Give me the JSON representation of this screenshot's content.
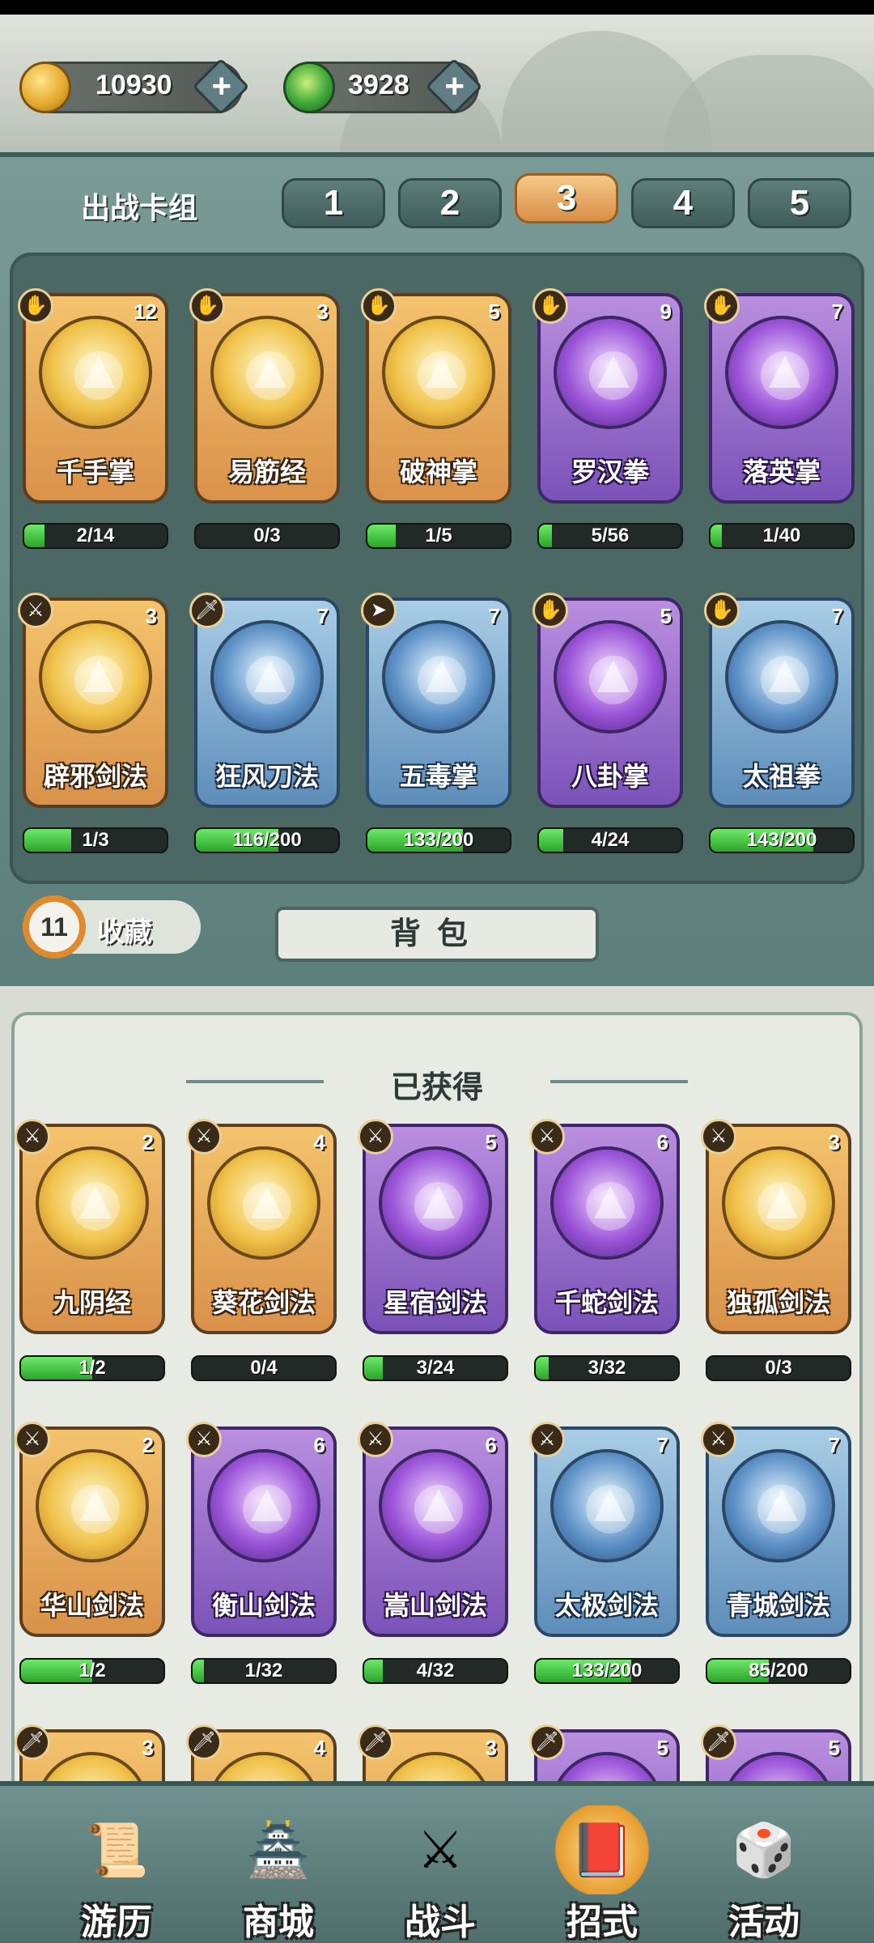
{
  "resources": {
    "gold": {
      "icon": "gold-coin-icon",
      "value": "10930",
      "add_label": "+"
    },
    "jade": {
      "icon": "jade-orb-icon",
      "value": "3928",
      "add_label": "+"
    }
  },
  "deck": {
    "label": "出战卡组",
    "tabs": [
      "1",
      "2",
      "3",
      "4",
      "5"
    ],
    "active_tab": "3",
    "cards": [
      {
        "name": "千手掌",
        "level": "12",
        "type_icon": "palm-icon",
        "rarity": "gold",
        "progress": "2/14",
        "fill": 0.14
      },
      {
        "name": "易筋经",
        "level": "3",
        "type_icon": "palm-icon",
        "rarity": "gold",
        "progress": "0/3",
        "fill": 0
      },
      {
        "name": "破神掌",
        "level": "5",
        "type_icon": "palm-icon",
        "rarity": "gold",
        "progress": "1/5",
        "fill": 0.2
      },
      {
        "name": "罗汉拳",
        "level": "9",
        "type_icon": "palm-icon",
        "rarity": "purple",
        "progress": "5/56",
        "fill": 0.09
      },
      {
        "name": "落英掌",
        "level": "7",
        "type_icon": "palm-icon",
        "rarity": "purple",
        "progress": "1/40",
        "fill": 0.03
      },
      {
        "name": "辟邪剑法",
        "level": "3",
        "type_icon": "sword-icon",
        "rarity": "gold",
        "progress": "1/3",
        "fill": 0.33
      },
      {
        "name": "狂风刀法",
        "level": "7",
        "type_icon": "blade-icon",
        "rarity": "blue",
        "progress": "116/200",
        "fill": 0.58
      },
      {
        "name": "五毒掌",
        "level": "7",
        "type_icon": "kick-icon",
        "rarity": "blue",
        "progress": "133/200",
        "fill": 0.67
      },
      {
        "name": "八卦掌",
        "level": "5",
        "type_icon": "palm-icon",
        "rarity": "purple",
        "progress": "4/24",
        "fill": 0.17
      },
      {
        "name": "太祖拳",
        "level": "7",
        "type_icon": "palm-icon",
        "rarity": "blue",
        "progress": "143/200",
        "fill": 0.72
      }
    ]
  },
  "collection": {
    "count": "11",
    "label": "收藏",
    "backpack_label": "背包",
    "obtained_title": "已获得",
    "cards": [
      {
        "name": "九阴经",
        "level": "2",
        "type_icon": "sword-icon",
        "rarity": "gold",
        "progress": "1/2",
        "fill": 0.5
      },
      {
        "name": "葵花剑法",
        "level": "4",
        "type_icon": "sword-icon",
        "rarity": "gold",
        "progress": "0/4",
        "fill": 0
      },
      {
        "name": "星宿剑法",
        "level": "5",
        "type_icon": "sword-icon",
        "rarity": "purple",
        "progress": "3/24",
        "fill": 0.13
      },
      {
        "name": "千蛇剑法",
        "level": "6",
        "type_icon": "sword-icon",
        "rarity": "purple",
        "progress": "3/32",
        "fill": 0.09
      },
      {
        "name": "独孤剑法",
        "level": "3",
        "type_icon": "sword-icon",
        "rarity": "gold",
        "progress": "0/3",
        "fill": 0
      },
      {
        "name": "华山剑法",
        "level": "2",
        "type_icon": "sword-icon",
        "rarity": "gold",
        "progress": "1/2",
        "fill": 0.5
      },
      {
        "name": "衡山剑法",
        "level": "6",
        "type_icon": "sword-icon",
        "rarity": "purple",
        "progress": "1/32",
        "fill": 0.03
      },
      {
        "name": "嵩山剑法",
        "level": "6",
        "type_icon": "sword-icon",
        "rarity": "purple",
        "progress": "4/32",
        "fill": 0.13
      },
      {
        "name": "太极剑法",
        "level": "7",
        "type_icon": "sword-icon",
        "rarity": "blue",
        "progress": "133/200",
        "fill": 0.67
      },
      {
        "name": "青城剑法",
        "level": "7",
        "type_icon": "sword-icon",
        "rarity": "blue",
        "progress": "85/200",
        "fill": 0.43
      },
      {
        "name": "",
        "level": "3",
        "type_icon": "blade-icon",
        "rarity": "gold",
        "progress": "",
        "fill": 0
      },
      {
        "name": "",
        "level": "4",
        "type_icon": "blade-icon",
        "rarity": "gold",
        "progress": "",
        "fill": 0
      },
      {
        "name": "",
        "level": "3",
        "type_icon": "blade-icon",
        "rarity": "gold",
        "progress": "",
        "fill": 0
      },
      {
        "name": "",
        "level": "5",
        "type_icon": "blade-icon",
        "rarity": "purple",
        "progress": "",
        "fill": 0
      },
      {
        "name": "",
        "level": "5",
        "type_icon": "blade-icon",
        "rarity": "purple",
        "progress": "",
        "fill": 0
      }
    ]
  },
  "nav": [
    {
      "label": "游历",
      "icon": "scroll-map-icon"
    },
    {
      "label": "商城",
      "icon": "shop-pavilion-icon"
    },
    {
      "label": "战斗",
      "icon": "crossed-swords-icon"
    },
    {
      "label": "招式",
      "icon": "skill-book-icon",
      "active": true
    },
    {
      "label": "活动",
      "icon": "dice-icon"
    }
  ]
}
